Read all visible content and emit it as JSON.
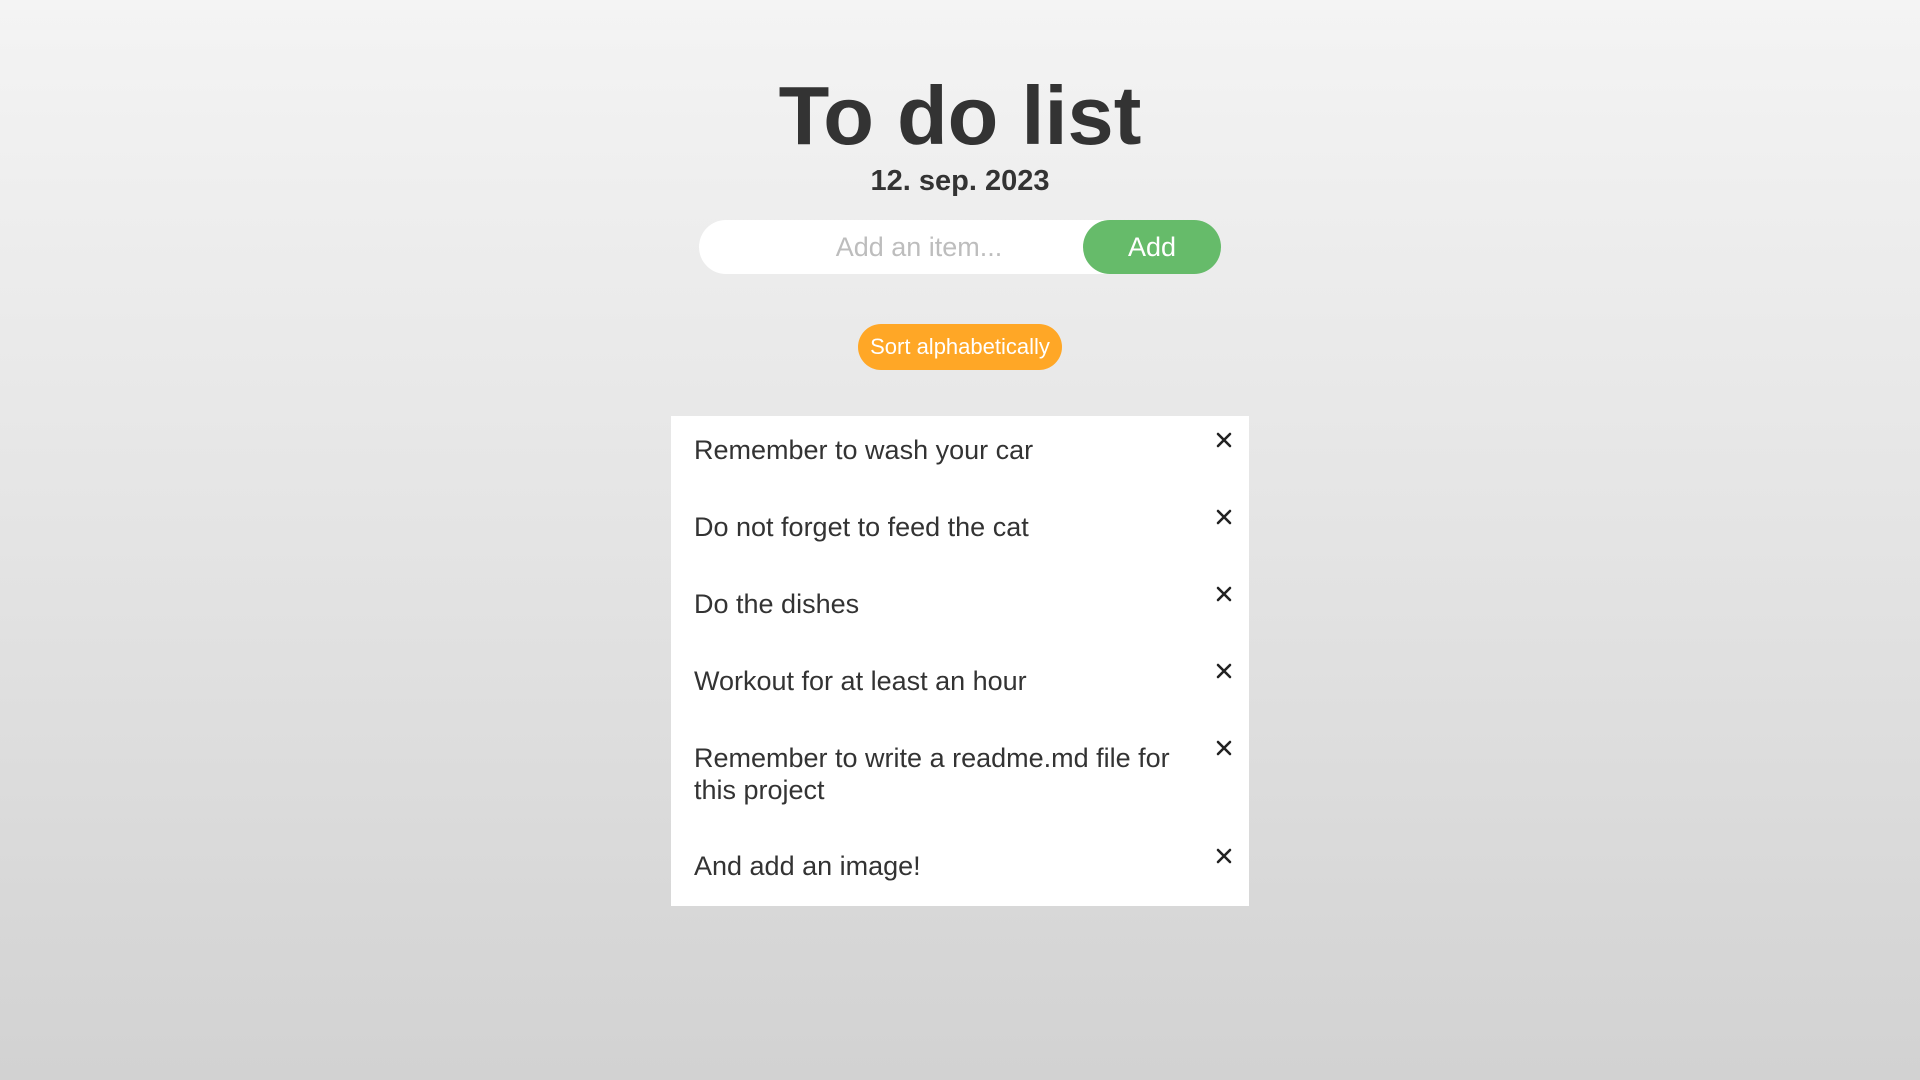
{
  "header": {
    "title": "To do list",
    "date": "12. sep. 2023"
  },
  "add_form": {
    "placeholder": "Add an item...",
    "value": "",
    "button_label": "Add"
  },
  "sort": {
    "button_label": "Sort alphabetically"
  },
  "todos": [
    {
      "text": "Remember to wash your car",
      "remove_icon": "close-icon"
    },
    {
      "text": "Do not forget to feed the cat",
      "remove_icon": "close-icon"
    },
    {
      "text": "Do the dishes",
      "remove_icon": "close-icon"
    },
    {
      "text": "Workout for at least an hour",
      "remove_icon": "close-icon"
    },
    {
      "text": "Remember to write a readme.md file for this project",
      "remove_icon": "close-icon"
    },
    {
      "text": "And add an image!",
      "remove_icon": "close-icon"
    }
  ],
  "colors": {
    "add_button": "#66bb6a",
    "sort_button": "#ffa726",
    "text": "#333333"
  }
}
